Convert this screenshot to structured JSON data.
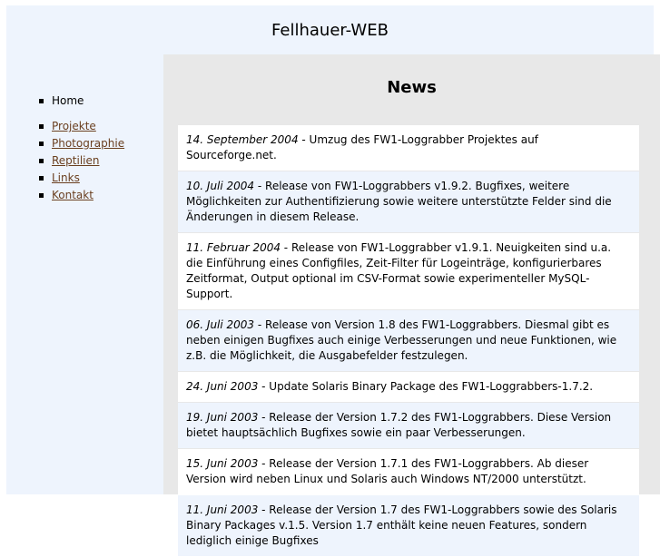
{
  "header": {
    "title": "Fellhauer-WEB"
  },
  "nav": {
    "current": "Home",
    "links": [
      "Projekte",
      "Photographie",
      "Reptilien",
      "Links",
      "Kontakt"
    ]
  },
  "main": {
    "title": "News",
    "items": [
      {
        "date": "14. September 2004",
        "text": " - Umzug des FW1-Loggrabber Projektes auf Sourceforge.net."
      },
      {
        "date": "10. Juli 2004",
        "text": " - Release von FW1-Loggrabbers v1.9.2. Bugfixes, weitere Möglichkeiten zur Authentifizierung sowie weitere unterstützte Felder sind die Änderungen in diesem Release."
      },
      {
        "date": "11. Februar 2004",
        "text": " - Release von FW1-Loggrabber v1.9.1. Neuigkeiten sind u.a. die Einführung eines Configfiles, Zeit-Filter für Logeinträge, konfigurierbares Zeitformat, Output optional im CSV-Format sowie experimenteller MySQL-Support."
      },
      {
        "date": "06. Juli 2003",
        "text": " - Release von Version 1.8 des FW1-Loggrabbers. Diesmal gibt es neben einigen Bugfixes auch einige Verbesserungen und neue Funktionen, wie z.B. die Möglichkeit, die Ausgabefelder festzulegen."
      },
      {
        "date": "24. Juni 2003",
        "text": " - Update Solaris Binary Package des FW1-Loggrabbers-1.7.2."
      },
      {
        "date": "19. Juni 2003",
        "text": " - Release der Version 1.7.2 des FW1-Loggrabbers. Diese Version bietet hauptsächlich Bugfixes sowie ein paar Verbesserungen."
      },
      {
        "date": "15. Juni 2003",
        "text": " - Release der Version 1.7.1 des FW1-Loggrabbers. Ab dieser Version wird neben Linux und Solaris auch Windows NT/2000 unterstützt."
      },
      {
        "date": "11. Juni 2003",
        "text": " - Release der Version 1.7 des FW1-Loggrabbers sowie des Solaris Binary Packages v.1.5. Version 1.7 enthält keine neuen Features, sondern lediglich einige Bugfixes"
      }
    ]
  }
}
